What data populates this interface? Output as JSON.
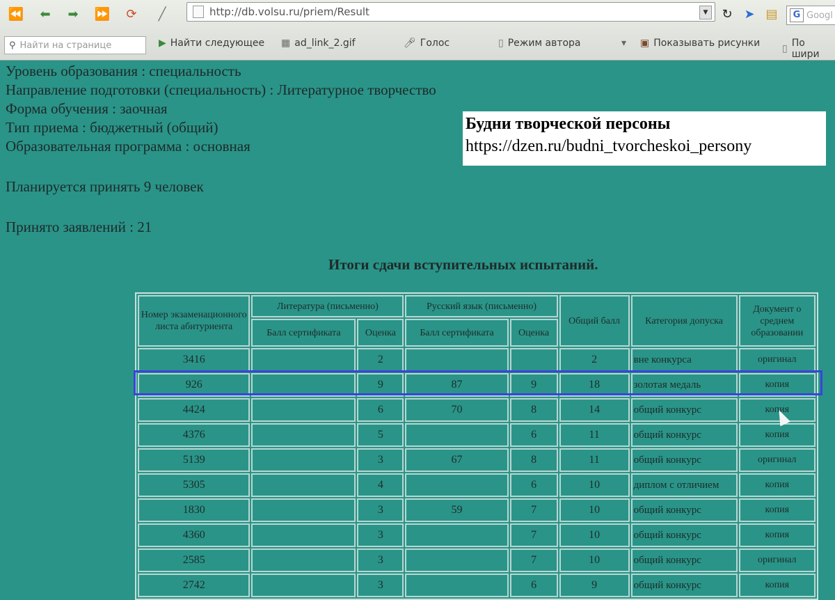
{
  "browser": {
    "url": "http://db.volsu.ru/priem/Result",
    "search_placeholder": "Googl",
    "find_placeholder": "Найти на странице",
    "toolbar": {
      "find_next": "Найти следующее",
      "attachment": "ad_link_2.gif",
      "voice": "Голос",
      "author_mode": "Режим автора",
      "show_images": "Показывать рисунки",
      "by_width": "По шири"
    }
  },
  "watermark": {
    "title": "Будни творческой персоны",
    "url": "https://dzen.ru/budni_tvorcheskoi_persony"
  },
  "info": {
    "level": "Уровень образования : специальность",
    "direction": "Направление подготовки (специальность) : Литературное творчество",
    "form": "Форма обучения : заочная",
    "admission_type": "Тип приема : бюджетный (общий)",
    "program": "Образовательная программа : основная",
    "planned": "Планируется принять 9 человек",
    "applications": "Принято заявлений : 21"
  },
  "results_title": "Итоги сдачи вступительных испытаний.",
  "table": {
    "headers": {
      "number": "Номер экзаменационного листа абитуриента",
      "literature": "Литература (письменно)",
      "russian": "Русский язык (письменно)",
      "cert": "Балл сертификата",
      "grade": "Оценка",
      "total": "Общий балл",
      "category": "Категория допуска",
      "document": "Документ о среднем образовании"
    },
    "rows": [
      {
        "num": "3416",
        "lit_cert": "",
        "lit_grade": "2",
        "rus_cert": "",
        "rus_grade": "",
        "total": "2",
        "category": "вне конкурса",
        "doc": "оригинал"
      },
      {
        "num": "926",
        "lit_cert": "",
        "lit_grade": "9",
        "rus_cert": "87",
        "rus_grade": "9",
        "total": "18",
        "category": "золотая медаль",
        "doc": "копия"
      },
      {
        "num": "4424",
        "lit_cert": "",
        "lit_grade": "6",
        "rus_cert": "70",
        "rus_grade": "8",
        "total": "14",
        "category": "общий конкурс",
        "doc": "копия"
      },
      {
        "num": "4376",
        "lit_cert": "",
        "lit_grade": "5",
        "rus_cert": "",
        "rus_grade": "6",
        "total": "11",
        "category": "общий конкурс",
        "doc": "копия"
      },
      {
        "num": "5139",
        "lit_cert": "",
        "lit_grade": "3",
        "rus_cert": "67",
        "rus_grade": "8",
        "total": "11",
        "category": "общий конкурс",
        "doc": "оригинал"
      },
      {
        "num": "5305",
        "lit_cert": "",
        "lit_grade": "4",
        "rus_cert": "",
        "rus_grade": "6",
        "total": "10",
        "category": "диплом с отличием",
        "doc": "копия"
      },
      {
        "num": "1830",
        "lit_cert": "",
        "lit_grade": "3",
        "rus_cert": "59",
        "rus_grade": "7",
        "total": "10",
        "category": "общий конкурс",
        "doc": "копия"
      },
      {
        "num": "4360",
        "lit_cert": "",
        "lit_grade": "3",
        "rus_cert": "",
        "rus_grade": "7",
        "total": "10",
        "category": "общий конкурс",
        "doc": "копия"
      },
      {
        "num": "2585",
        "lit_cert": "",
        "lit_grade": "3",
        "rus_cert": "",
        "rus_grade": "7",
        "total": "10",
        "category": "общий конкурс",
        "doc": "оригинал"
      },
      {
        "num": "2742",
        "lit_cert": "",
        "lit_grade": "3",
        "rus_cert": "",
        "rus_grade": "6",
        "total": "9",
        "category": "общий конкурс",
        "doc": "копия"
      }
    ]
  }
}
